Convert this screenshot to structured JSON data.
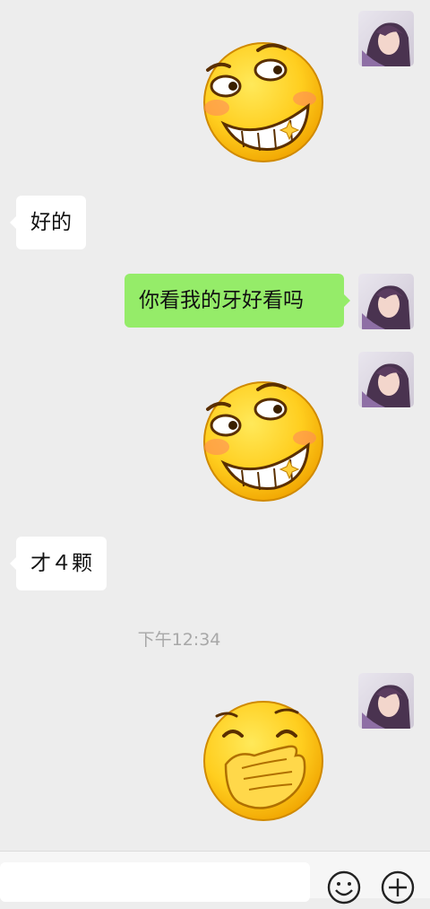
{
  "messages": [
    {
      "side": "right",
      "type": "sticker",
      "sticker": "grin-teeth-sticker"
    },
    {
      "side": "left",
      "type": "text",
      "text": "好的"
    },
    {
      "side": "right",
      "type": "text",
      "text": "你看我的牙好看吗"
    },
    {
      "side": "right",
      "type": "sticker",
      "sticker": "grin-teeth-sticker"
    },
    {
      "side": "left",
      "type": "text",
      "text": "才４颗"
    },
    {
      "side": "right",
      "type": "sticker",
      "sticker": "cover-mouth-laugh-sticker"
    }
  ],
  "timestamp": "下午12:34",
  "input_bar": {
    "emoji_icon": "emoji-icon",
    "plus_icon": "plus-icon",
    "input_value": ""
  },
  "colors": {
    "background": "#ededed",
    "bubble_self": "#95ec69",
    "bubble_other": "#ffffff",
    "timestamp": "#a8a8a8"
  }
}
